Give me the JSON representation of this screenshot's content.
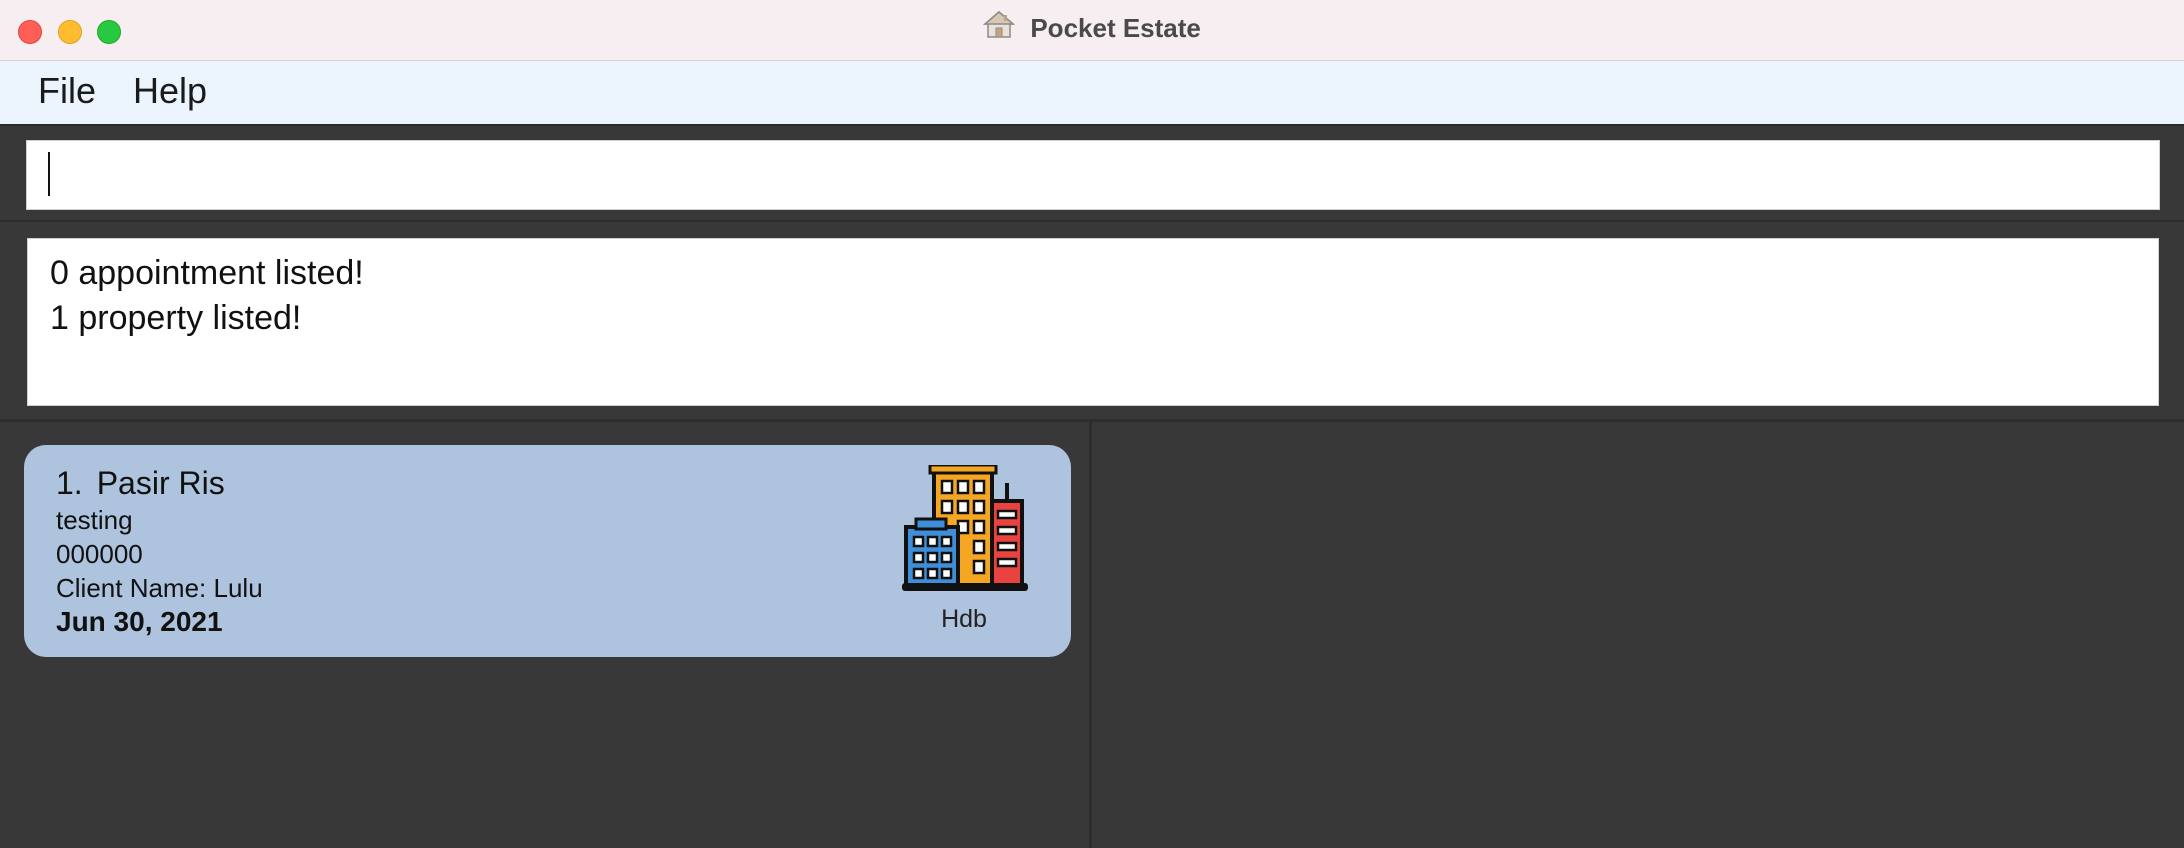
{
  "window": {
    "title": "Pocket Estate",
    "title_icon": "house-icon"
  },
  "menubar": {
    "items": [
      {
        "label": "File"
      },
      {
        "label": "Help"
      }
    ]
  },
  "command_box": {
    "value": "",
    "placeholder": ""
  },
  "result_display": {
    "lines": [
      "0 appointment listed!",
      "1 property listed!"
    ]
  },
  "property_list": [
    {
      "index": "1.",
      "name": "Pasir Ris",
      "description": "testing",
      "postal": "000000",
      "client": "Client Name: Lulu",
      "deadline": "Jun 30, 2021",
      "type": "Hdb",
      "type_icon": "hdb-building-icon"
    }
  ],
  "appointment_list": [],
  "colors": {
    "card_bg": "#adc3de",
    "panel_bg": "#383838",
    "menubar_bg": "#ecf4fd",
    "titlebar_bg": "#f6eef1"
  }
}
